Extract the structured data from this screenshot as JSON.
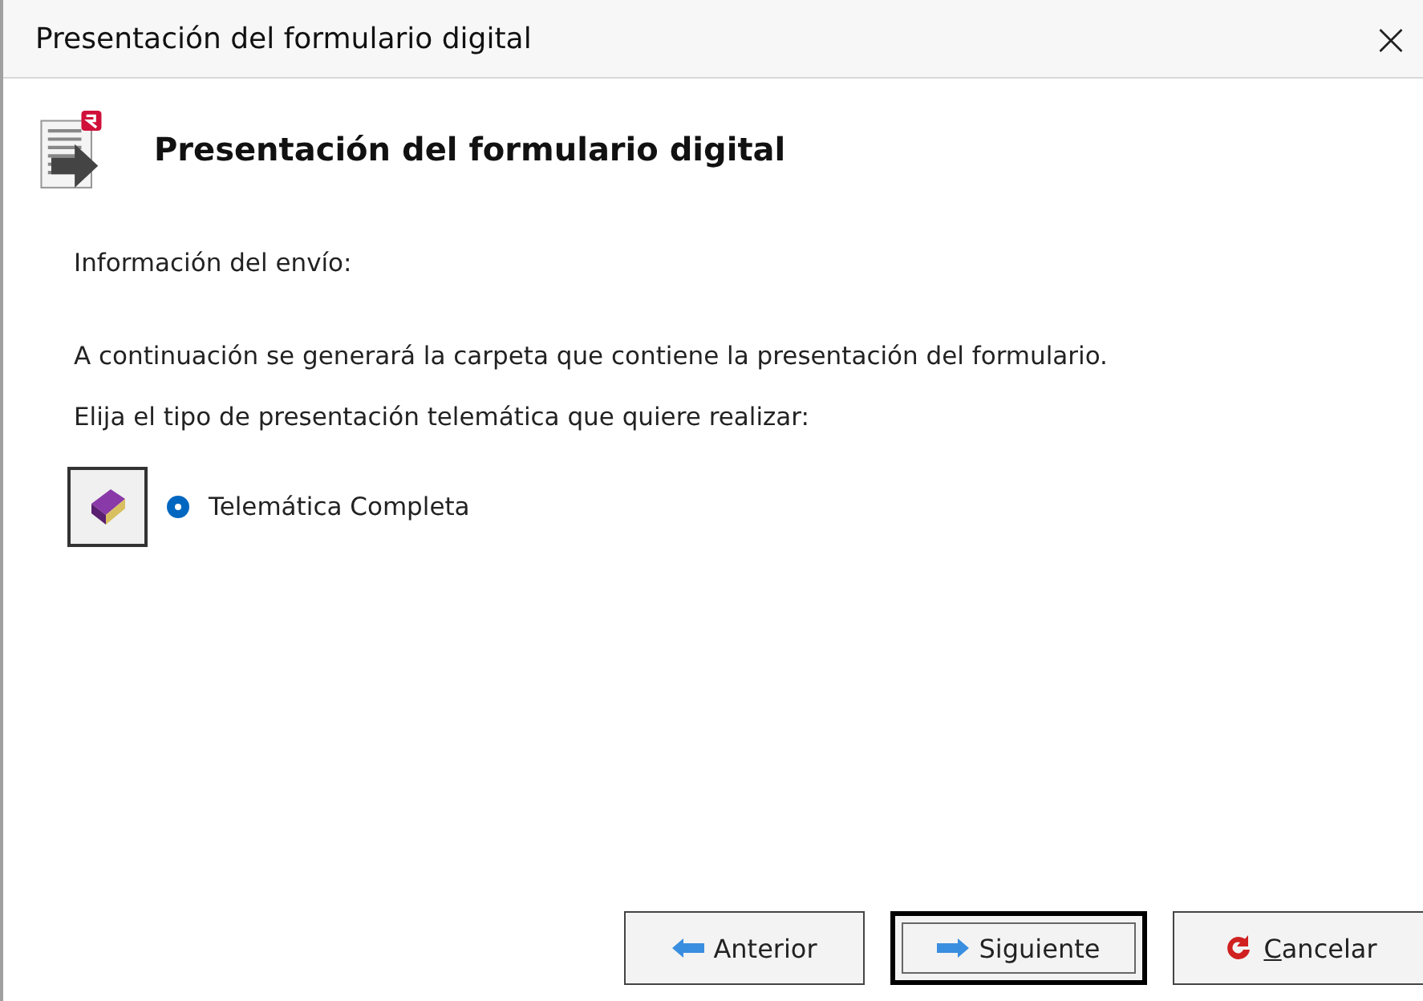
{
  "window": {
    "title": "Presentación del formulario digital",
    "close": "×"
  },
  "header": {
    "title": "Presentación del formulario digital"
  },
  "body": {
    "section_label": "Información del envío:",
    "description": "A continuación se generará la carpeta que contiene la presentación del formulario.",
    "prompt": "Elija el tipo de presentación telemática que quiere realizar:"
  },
  "options": [
    {
      "label": "Telemática Completa",
      "selected": true
    }
  ],
  "buttons": [
    {
      "kind": "back",
      "label": "Anterior",
      "default": false,
      "mnemonic_first": false
    },
    {
      "kind": "next",
      "label": "Siguiente",
      "default": true,
      "mnemonic_first": false
    },
    {
      "kind": "cancel",
      "label": "Cancelar",
      "default": false,
      "mnemonic_first": true
    }
  ]
}
